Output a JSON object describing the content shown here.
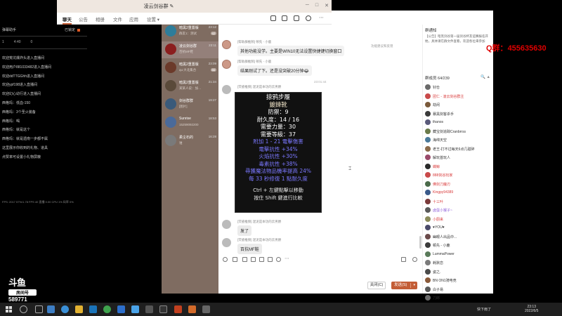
{
  "overlay": {
    "title": "弹幕助手",
    "online_label": "已锁定",
    "stats": [
      "1",
      "4:40",
      "0"
    ],
    "lines": [
      "欢迎荒坑爆炸头进入直播间",
      "欢迎用户881033482进入直播间",
      "欢迎ddTTGGhh进入直播间",
      "欢迎ypf198进入直播间",
      "欢迎幻心幼行进入直播间",
      "西格玛：低血-150",
      "西格玛：3个圣火装备",
      "西格玛：喝",
      "西格玛：就是这个",
      "西格玛：就是遗南一步都不属",
      "这里展示你收到的礼物、道具",
      "点赞率可设置小礼物屏蔽"
    ],
    "footer": "FPS: 2017  57%/1.78  FPS 40  直播  0.00  CPU 1%  码率  0%"
  },
  "douyu": {
    "logo": "斗鱼",
    "room_label": "房间号",
    "room_number": "589771"
  },
  "window": {
    "title": "凌云剑谷群",
    "title_icon": "edit-icon",
    "controls": [
      "─",
      "□",
      "✕"
    ]
  },
  "conversations": {
    "search_placeholder": "搜索",
    "add_label": "+",
    "items": [
      {
        "name": "暗黑2重置版",
        "time": "23:12",
        "msg": "群友1：测试",
        "badge": "42",
        "color": "#2e7d9a",
        "active": false
      },
      {
        "name": "凌云剑谷群",
        "time": "23:11",
        "msg": "百抗MF鞋",
        "badge": "",
        "color": "#8b1e1e",
        "active": true
      },
      {
        "name": "暗黑2重置版",
        "time": "23:09",
        "msg": "qu:大北集合",
        "badge": "86",
        "color": "#6b3a2a",
        "active": false
      },
      {
        "name": "暗黑2重置版",
        "time": "21:34",
        "msg": "某某人说：加…",
        "badge": "",
        "color": "#5a4a3a",
        "active": false
      },
      {
        "name": "剑谷群群",
        "time": "19:27",
        "msg": "[图片]",
        "badge": "",
        "color": "#3a5a7a",
        "active": false
      },
      {
        "name": "Sunrise",
        "time": "18:53",
        "msg": "15259092200",
        "badge": "",
        "color": "#4a6a9a",
        "active": false
      },
      {
        "name": "柔尘石的",
        "time": "16:28",
        "msg": "谁",
        "badge": "",
        "color": "#7a7a7a",
        "active": false
      }
    ]
  },
  "tabs": [
    "聊天",
    "公告",
    "相册",
    "文件",
    "应用",
    "设置 ▾"
  ],
  "messages": [
    {
      "sender": "[帮助群推频] 顿先 - 小鹿",
      "text": "其他功能没学。主要是WIN10无法设置快捷键切换窗口",
      "gray": false
    },
    {
      "sender": "[帮助群推频] 顿先 - 小鹿",
      "text": "结果刚试了下。还是没突破20分钟😂",
      "gray": false
    },
    {
      "sender": "[荧惑推频] 混泥是本功的云男爵",
      "text": "",
      "gray": false
    },
    {
      "sender": "[荧惑推频] 混泥是本功的云男爵",
      "text": "发了",
      "gray": true
    },
    {
      "sender": "[荧惑推频] 混泥是本功的云男爵",
      "text": "百抗MF鞋",
      "gray": true
    }
  ],
  "timestamp": "23:01:44",
  "notice_link": "功能建议和反馈",
  "item_card": {
    "lines": [
      {
        "text": "掠鸦步履",
        "style": "title"
      },
      {
        "text": "鍍鍊靴",
        "style": "gold"
      },
      {
        "text": "防禦：9",
        "style": "white"
      },
      {
        "text": "耐久度：14 / 16",
        "style": "white"
      },
      {
        "text": "需要力量：30",
        "style": "white"
      },
      {
        "text": "需要等級：37",
        "style": "white"
      },
      {
        "text": "附加 1 - 21 電擊傷害",
        "style": "blue"
      },
      {
        "text": "電擊抗性 +34%",
        "style": "blue"
      },
      {
        "text": "火焰抗性 +30%",
        "style": "blue"
      },
      {
        "text": "毒素抗性 +38%",
        "style": "blue"
      },
      {
        "text": "尋獲魔法物品機率提高 24%",
        "style": "blue"
      },
      {
        "text": "每 33 秒修復 1 點耐久度",
        "style": "blue"
      },
      {
        "text": "Ctrl + 左鍵點擊以移動",
        "style": "hint"
      },
      {
        "text": "按住 Shift 鍵進行比較",
        "style": "hint"
      }
    ]
  },
  "buttons": {
    "close": "关闭(C)",
    "send": "发送(S)",
    "send_chevron": "▾"
  },
  "right_panel": {
    "notice_title": "群通知",
    "notice_text": "【公告】暗黑剑谷第一届剑谷杯友谊赛报名开始，具体请在群文件查看，欢迎各位来参加",
    "members_title": "群成员 64/239",
    "members_tools": "🔍 ▲",
    "members": [
      {
        "name": "钊仓",
        "style": "",
        "color": "#6a6a6a"
      },
      {
        "name": "团仁 - 凌云剑谷群主",
        "style": "red",
        "color": "#c94a4a"
      },
      {
        "name": "劫闲",
        "style": "",
        "color": "#7a5a3a"
      },
      {
        "name": "暴黑剑客杀手",
        "style": "",
        "color": "#3a3a3a"
      },
      {
        "name": "thanos",
        "style": "",
        "color": "#5a5a7a"
      },
      {
        "name": "藏宝剑追踪Cranbrrss",
        "style": "",
        "color": "#6a7a4a"
      },
      {
        "name": "海绵天空",
        "style": "",
        "color": "#4a7a9a"
      },
      {
        "name": "老王-打不过每天6点几碰碎",
        "style": "",
        "color": "#8a6a4a"
      },
      {
        "name": "解玩首玩人",
        "style": "",
        "color": "#9a4a6a"
      },
      {
        "name": "蝶鲸",
        "style": "red",
        "color": "#2a2a2a"
      },
      {
        "name": "888剑谷玩家",
        "style": "red",
        "color": "#c94a4a"
      },
      {
        "name": "佛剑刀魔刃",
        "style": "red",
        "color": "#4a6a4a"
      },
      {
        "name": "Kingpy94389",
        "style": "red",
        "color": "#3a5a8a"
      },
      {
        "name": "十三叶",
        "style": "red",
        "color": "#7a3a3a"
      },
      {
        "name": "卤蛋小猴子~",
        "style": "purple",
        "color": "#5a5a5a"
      },
      {
        "name": "小厨来",
        "style": "red",
        "color": "#8a8a5a"
      },
      {
        "name": "♥YOU♥",
        "style": "",
        "color": "#4a4a6a"
      },
      {
        "name": "幽眼人出品中...",
        "style": "",
        "color": "#6a4a4a"
      },
      {
        "name": "顿先 - 小鹿",
        "style": "",
        "color": "#3a3a3a"
      },
      {
        "name": "LummaPower",
        "style": "",
        "color": "#5a7a5a"
      },
      {
        "name": "耗默恋",
        "style": "",
        "color": "#7a7a7a"
      },
      {
        "name": "姿之.",
        "style": "",
        "color": "#4a4a4a"
      },
      {
        "name": "BN ON1骑电竞",
        "style": "",
        "color": "#8a5a3a"
      },
      {
        "name": "白子易",
        "style": "",
        "color": "#5a5a5a"
      },
      {
        "name": "刀郎",
        "style": "",
        "color": "#6a6a6a"
      }
    ]
  },
  "qq": {
    "label": "Q群：",
    "number": "455635630"
  },
  "taskbar": {
    "tray_text": "快下雨了",
    "time": "23:13",
    "date": "2022/6/5"
  }
}
